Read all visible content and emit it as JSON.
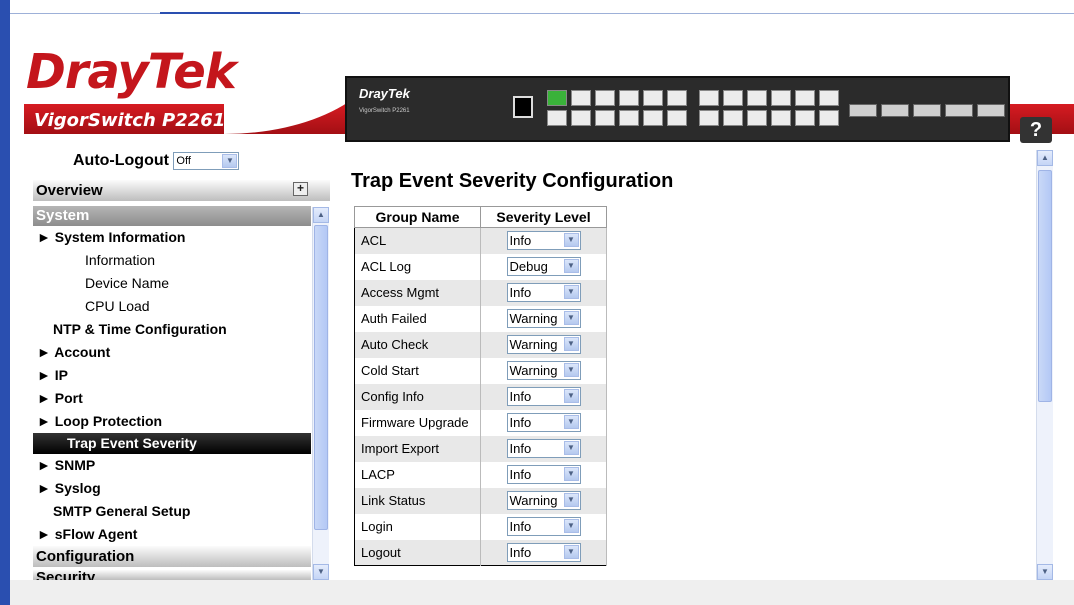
{
  "header": {
    "logo": "DrayTek",
    "model": "VigorSwitch P2261",
    "device_brand": "DrayTek",
    "device_sub": "VigorSwitch P2261",
    "help_label": "?"
  },
  "sidebar": {
    "autologout_label": "Auto-Logout",
    "autologout_value": "Off",
    "overview_label": "Overview",
    "system_label": "System",
    "items": [
      {
        "label": "► System Information",
        "kind": "bold"
      },
      {
        "label": "Information",
        "kind": "sub"
      },
      {
        "label": "Device Name",
        "kind": "sub"
      },
      {
        "label": "CPU Load",
        "kind": "sub"
      },
      {
        "label": "NTP & Time Configuration",
        "kind": "plain"
      },
      {
        "label": "► Account",
        "kind": "bold"
      },
      {
        "label": "► IP",
        "kind": "bold"
      },
      {
        "label": "► Port",
        "kind": "bold"
      },
      {
        "label": "► Loop Protection",
        "kind": "bold"
      },
      {
        "label": "Trap Event Severity",
        "kind": "active"
      },
      {
        "label": "► SNMP",
        "kind": "bold"
      },
      {
        "label": "► Syslog",
        "kind": "bold"
      },
      {
        "label": "SMTP General Setup",
        "kind": "plain"
      },
      {
        "label": "► sFlow Agent",
        "kind": "bold"
      }
    ],
    "configuration_label": "Configuration",
    "security_label": "Security"
  },
  "main": {
    "title": "Trap Event Severity Configuration",
    "columns": [
      "Group Name",
      "Severity Level"
    ],
    "rows": [
      {
        "name": "ACL",
        "level": "Info"
      },
      {
        "name": "ACL Log",
        "level": "Debug"
      },
      {
        "name": "Access Mgmt",
        "level": "Info"
      },
      {
        "name": "Auth Failed",
        "level": "Warning"
      },
      {
        "name": "Auto Check",
        "level": "Warning"
      },
      {
        "name": "Cold Start",
        "level": "Warning"
      },
      {
        "name": "Config Info",
        "level": "Info"
      },
      {
        "name": "Firmware Upgrade",
        "level": "Info"
      },
      {
        "name": "Import Export",
        "level": "Info"
      },
      {
        "name": "LACP",
        "level": "Info"
      },
      {
        "name": "Link Status",
        "level": "Warning"
      },
      {
        "name": "Login",
        "level": "Info"
      },
      {
        "name": "Logout",
        "level": "Info"
      }
    ]
  },
  "colors": {
    "brand_red": "#c4161c",
    "active_menu": "#000000",
    "row_alt": "#e8e8e8"
  }
}
